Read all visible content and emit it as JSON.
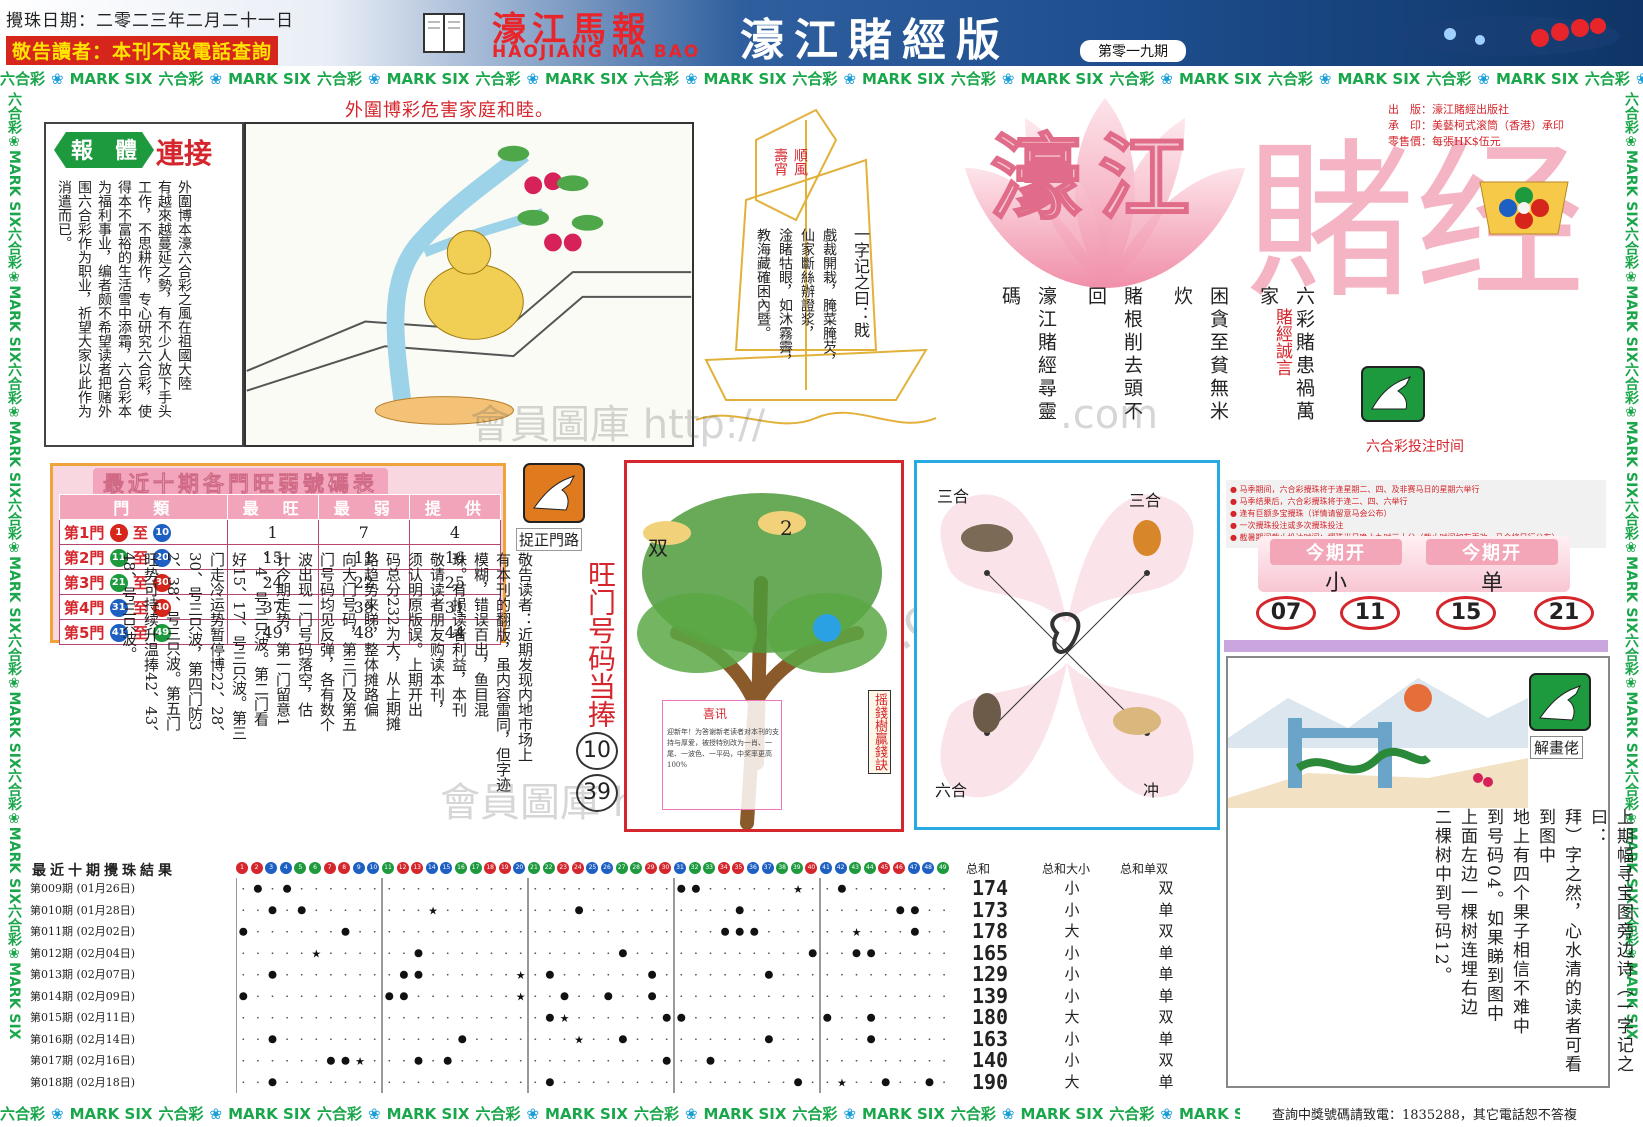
{
  "header": {
    "date": "攪珠日期：二零二三年二月二十一日",
    "notice": "敬告讀者：本刊不設電話查詢",
    "masthead_cn": "濠江馬報",
    "masthead_en": "HAOJIANG MA BAO",
    "edition_title": "濠江賭經版",
    "issue_no": "第零一九期"
  },
  "strip_text": {
    "cn": "六合彩",
    "en": "MARK SIX"
  },
  "slogan": "外圍博彩危害家庭和睦。",
  "article": {
    "badge": [
      "報",
      "體"
    ],
    "title": "連接",
    "text": [
      "外圍博本濠六合彩之風在祖國大陸",
      "有越來越蔓延之勢，有不少人放下手头",
      "工作，不思耕作，专心研究六合彩，使",
      "得本不富裕的生活雪中添霜，六合彩本",
      "为福利事业，编者颇不希望读者把赌外",
      "围六合彩作为职业，祈望大家以此作为",
      "消遣而已。"
    ]
  },
  "boat": {
    "flag": [
      "順風",
      "壽宵"
    ],
    "poem_head": "一字记之曰：戝",
    "poem_body": [
      "戲裁開栽，腌菜腌芡，",
      "仙家斷絲辦證浆，",
      "淦睹牯眼，如沐霧霽，",
      "教海藏確困內暨。"
    ]
  },
  "title_block": {
    "big_title_1": "濠江",
    "big_title_2": "賭经",
    "publisher": [
      "出　版：濠江賭經出版社",
      "承　印：美藝柯式滚筒（香港）承印",
      "零售價：每張HK$伍元"
    ],
    "proverb_label": "賭經誠言",
    "proverb_lines": [
      "六彩賭患禍萬家",
      "困貪至貧無米炊",
      "賭根削去頭不回",
      "濠江賭經尋靈碼"
    ]
  },
  "watermarks": [
    "會員圖庫 http://",
    ".com",
    "uuu.com",
    "會員圖庫 http://",
    ".com"
  ],
  "schedule": {
    "title": "六合彩投注时间",
    "items": [
      "马季期间，六合彩攪珠将于逢星期二、四、及非赛马日的星期六举行",
      "马季结果后，六合彩攪珠将于逢二、四、六举行",
      "逢有巨额多宝攪珠（详情请留意马会公布）",
      "一次攪珠投注或多次攪珠投注",
      "截暑期间截止投注时间：攪珠当日晚上九时三十分（截止时间如有更改，马会将另行公布）"
    ]
  },
  "this_period": {
    "head_a": "今期开",
    "val_a": "小",
    "head_b": "今期开",
    "val_b": "单",
    "picks": [
      "07",
      "11",
      "15",
      "21"
    ]
  },
  "strength_table": {
    "title": "最近十期各門旺弱號碼表",
    "headers": [
      "門　類",
      "最　旺",
      "最　弱",
      "提　供"
    ],
    "rows": [
      {
        "door": "第1門",
        "from": "1",
        "to": "10",
        "from_c": "r",
        "to_c": "b",
        "hot": "1",
        "cold": "7",
        "tip": "4"
      },
      {
        "door": "第2門",
        "from": "11",
        "to": "20",
        "from_c": "g",
        "to_c": "b",
        "hot": "15",
        "cold": "11",
        "tip": "16"
      },
      {
        "door": "第3門",
        "from": "21",
        "to": "30",
        "from_c": "g",
        "to_c": "r",
        "hot": "24",
        "cold": "22",
        "tip": "25"
      },
      {
        "door": "第4門",
        "from": "31",
        "to": "40",
        "from_c": "b",
        "to_c": "r",
        "hot": "37",
        "cold": "39",
        "tip": "31"
      },
      {
        "door": "第5門",
        "from": "41",
        "to": "49",
        "from_c": "b",
        "to_c": "g",
        "hot": "49",
        "cold": "48",
        "tip": "44"
      }
    ],
    "to_word": "至"
  },
  "corrector": {
    "label": "捉正門路",
    "text": [
      "敬告读者：近期发现内地市场上",
      "有本刊的翻版，虽内容雷同，但字迹",
      "模糊，错误百出，鱼目混",
      "珠。有损读者利益，本刊",
      "敬请读者朋友购读本刊，",
      "须认明原版误。上期开出",
      "码总分232为大，从上期摊",
      "路趋势来睇，整体摊路偏",
      "向大门号码，第三门及第五",
      "门号码均见反弹，各有数个",
      "波出现一门号码落空，估",
      "计今期走势，第一门留意1",
      "、4、号三只波。第二门看",
      "好15、17、号三只波。第三",
      "门走冷运势暂停博22、28、",
      "30、号三只波，第四门防3",
      "2、38、号三只波。第五门",
      "旺势可持续升温捧42、43、",
      "48、号三只波。"
    ],
    "lucky_title": "旺门号码当捧",
    "lucky_balls": [
      "10",
      "39"
    ]
  },
  "money_tree": {
    "label": "摇錢樹贏錢訣",
    "num_a": "双",
    "num_b": "2",
    "card_title": "喜讯",
    "card_text": "迎新年！为答谢新老读者对本刊的支持与厚爱，被授特别改为一肖、一尾、一波色、一平码，中奖率更高100%"
  },
  "zodiac": {
    "top_left": "三合",
    "top_right": "三合",
    "bottom_left": "六合",
    "bottom_right": "冲"
  },
  "explain": {
    "label": "解畫佬",
    "text": [
      "上期幅寻宝图旁边诗（一字记之曰：",
      "拜）字之然，心水清的读者可看到图中",
      "地上有四个果子相信不难中",
      "到号码04。如果睇到图中",
      "上面左边一棵树连埋右边",
      "二棵树中到号码12。"
    ]
  },
  "results": {
    "title": "最近十期攪珠結果",
    "sum_head": "总和",
    "size_head": "总和大小",
    "parity_head": "总和单双",
    "rows": [
      {
        "label": "第009期 (01月26日)",
        "sum": "174",
        "size": "小",
        "parity": "双",
        "balls": [
          2,
          4,
          31,
          32,
          42
        ],
        "special": 39
      },
      {
        "label": "第010期 (01月28日)",
        "sum": "173",
        "size": "小",
        "parity": "单",
        "balls": [
          3,
          5,
          24,
          35,
          46,
          47
        ],
        "special": 14
      },
      {
        "label": "第011期 (02月02日)",
        "sum": "178",
        "size": "大",
        "parity": "双",
        "balls": [
          1,
          8,
          34,
          35,
          36,
          47
        ],
        "special": 43
      },
      {
        "label": "第012期 (02月04日)",
        "sum": "165",
        "size": "小",
        "parity": "单",
        "balls": [
          13,
          27,
          40,
          43,
          44
        ],
        "special": 6
      },
      {
        "label": "第013期 (02月07日)",
        "sum": "129",
        "size": "小",
        "parity": "单",
        "balls": [
          3,
          12,
          13,
          22,
          29,
          37
        ],
        "special": 20
      },
      {
        "label": "第014期 (02月09日)",
        "sum": "139",
        "size": "小",
        "parity": "单",
        "balls": [
          1,
          11,
          12,
          23,
          26,
          29
        ],
        "special": 20
      },
      {
        "label": "第015期 (02月11日)",
        "sum": "180",
        "size": "大",
        "parity": "双",
        "balls": [
          22,
          30,
          31,
          41,
          44
        ],
        "special": 23
      },
      {
        "label": "第016期 (02月14日)",
        "sum": "163",
        "size": "小",
        "parity": "单",
        "balls": [
          3,
          16,
          27,
          37,
          44
        ],
        "special": 24
      },
      {
        "label": "第017期 (02月16日)",
        "sum": "140",
        "size": "小",
        "parity": "双",
        "balls": [
          7,
          8,
          13,
          15,
          30,
          33
        ],
        "special": 9
      },
      {
        "label": "第018期 (02月18日)",
        "sum": "190",
        "size": "大",
        "parity": "单",
        "balls": [
          3,
          22,
          39,
          45,
          48
        ],
        "special": 42
      }
    ]
  },
  "footer": {
    "tip": "查詢中獎號碼請致電：1835288，其它電話恕不答複"
  },
  "colors": {
    "red": "#d4262c",
    "green": "#1c9a3d",
    "blue": "#1d5fc2",
    "pink": "#f4b4c3",
    "cyan_border": "#27a9e1"
  }
}
